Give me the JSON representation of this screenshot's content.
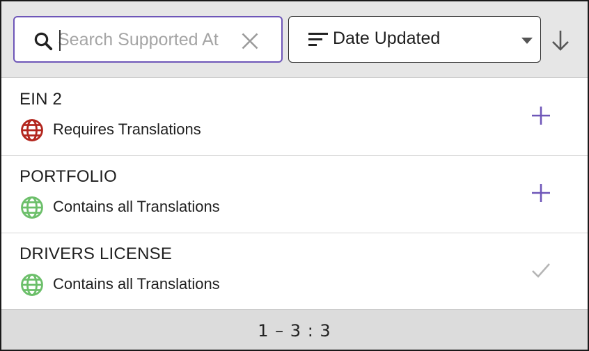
{
  "search": {
    "placeholder": "Search Supported At",
    "value": ""
  },
  "sort": {
    "label": "Date Updated",
    "direction": "descending"
  },
  "items": [
    {
      "title": "EIN 2",
      "status": "Requires Translations",
      "globe_color": "#b3261e",
      "action": "plus-icon"
    },
    {
      "title": "PORTFOLIO",
      "status": "Contains all Translations",
      "globe_color": "#6cbf6a",
      "action": "plus-icon"
    },
    {
      "title": "DRIVERS LICENSE",
      "status": "Contains all Translations",
      "globe_color": "#6cbf6a",
      "action": "check-icon"
    }
  ],
  "pagination": {
    "text": "1 – 3 : 3"
  },
  "colors": {
    "accent": "#6e56b8",
    "check": "#b5b5b5"
  }
}
